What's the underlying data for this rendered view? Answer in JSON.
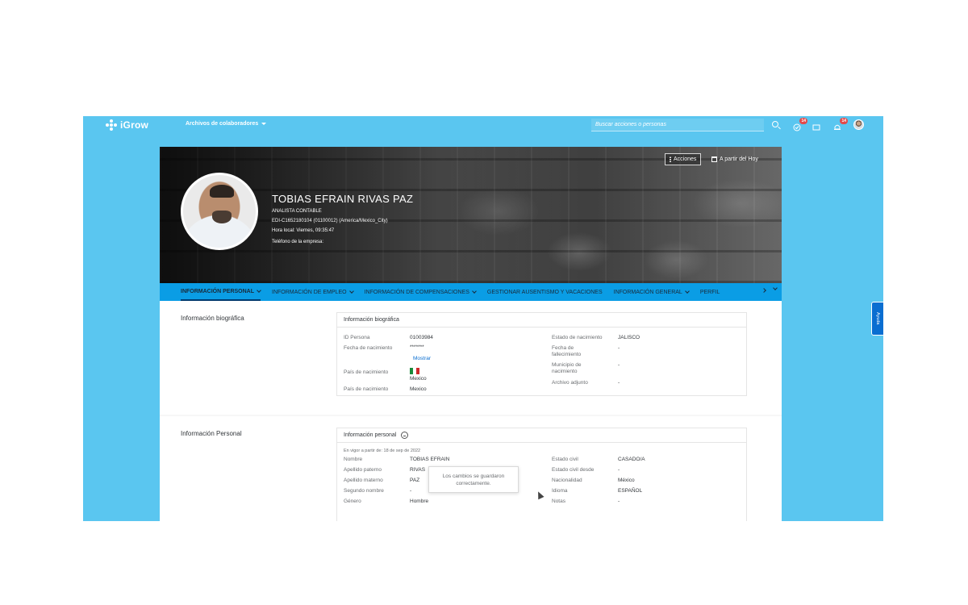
{
  "shell": {
    "logo_text": "iGrow",
    "nav_menu": "Archivos de colaboradores",
    "search_placeholder": "Buscar acciones o personas",
    "badge_1": "14",
    "badge_2": "14"
  },
  "hero": {
    "name": "TOBIAS EFRAIN RIVAS PAZ",
    "title": "ANALISTA CONTABLE",
    "id_line": "EDI-C1652180104 (01100012) (America/Mexico_City)",
    "local_time": "Hora local: Viernes, 09:35:47",
    "phone_label": "Teléfono de la empresa:",
    "actions_label": "Acciones",
    "date_label": "A partir del Hoy"
  },
  "tabs": [
    {
      "label": "INFORMACIÓN PERSONAL"
    },
    {
      "label": "INFORMACIÓN DE EMPLEO"
    },
    {
      "label": "INFORMACIÓN DE COMPENSACIONES"
    },
    {
      "label": "GESTIONAR AUSENTISMO Y VACACIONES"
    },
    {
      "label": "INFORMACIÓN GENERAL"
    },
    {
      "label": "PERFIL"
    }
  ],
  "bio": {
    "section_title": "Información biográfica",
    "card_title": "Información biográfica",
    "id_label": "ID Persona",
    "id_value": "01003984",
    "dob_label": "Fecha de nacimiento",
    "dob_value": "*******",
    "show_link": "Mostrar",
    "country_label": "País de nacimiento",
    "country_value": "Mexico",
    "country2_label": "País de nacimiento",
    "country2_value": "Mexico",
    "state_label": "Estado de nacimiento",
    "state_value": "JALISCO",
    "death_label": "Fecha de fallecimiento",
    "death_value": "-",
    "municipality_label": "Municipio de nacimiento",
    "municipality_value": "-",
    "attachment_label": "Archivo adjunto",
    "attachment_value": "-"
  },
  "personal": {
    "section_title": "Información Personal",
    "card_title": "Información personal",
    "effective_date": "En vigor a partir de: 18 de sep de 2022",
    "rows_left": [
      {
        "label": "Nombre",
        "value": "TOBIAS EFRAIN"
      },
      {
        "label": "Apellido paterno",
        "value": "RIVAS"
      },
      {
        "label": "Apellido materno",
        "value": "PAZ"
      },
      {
        "label": "Segundo nombre",
        "value": "-"
      },
      {
        "label": "Género",
        "value": "Hombre"
      }
    ],
    "rows_right": [
      {
        "label": "Estado civil",
        "value": "CASADO/A"
      },
      {
        "label": "Estado civil desde",
        "value": "-"
      },
      {
        "label": "Nacionalidad",
        "value": "México"
      },
      {
        "label": "Idioma",
        "value": "ESPAÑOL"
      },
      {
        "label": "Notas",
        "value": "-"
      }
    ]
  },
  "toast": {
    "line1": "Los cambios se guardaron",
    "line2": "correctamente."
  },
  "side_button": "Ayuda",
  "colors": {
    "shell": "#5ac6f0",
    "tabs": "#0a9de5",
    "link": "#0a6ed1"
  }
}
